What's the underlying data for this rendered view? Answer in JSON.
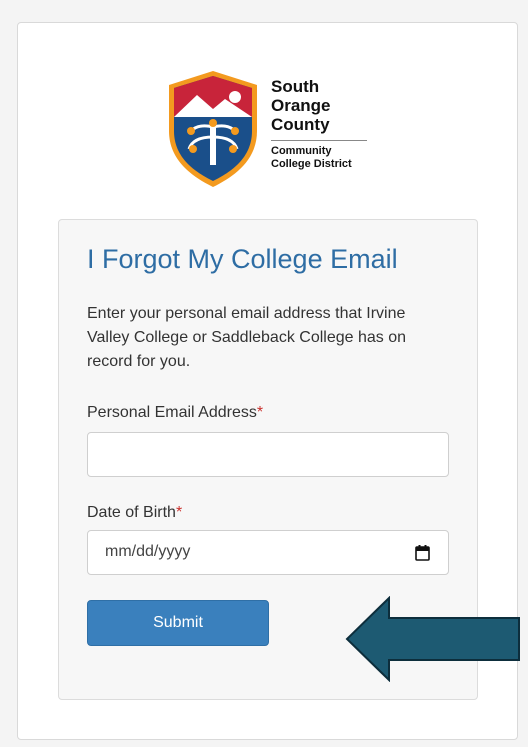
{
  "logo": {
    "line1": "South",
    "line2": "Orange",
    "line3": "County",
    "line4": "Community",
    "line5": "College District"
  },
  "form": {
    "title": "I Forgot My College Email",
    "intro": "Enter your personal email address that Irvine Valley College or Saddleback College has on record for you.",
    "email_label": "Personal Email Address",
    "email_value": "",
    "required_marker": "*",
    "dob_label": "Date of Birth",
    "dob_placeholder": "mm/dd/yyyy",
    "submit_label": "Submit"
  },
  "colors": {
    "title": "#2e6da4",
    "button": "#3a80bd",
    "arrow": "#1d5a72",
    "required": "#c9302c"
  },
  "icons": {
    "calendar": "calendar-icon",
    "arrow": "left-arrow-icon"
  }
}
